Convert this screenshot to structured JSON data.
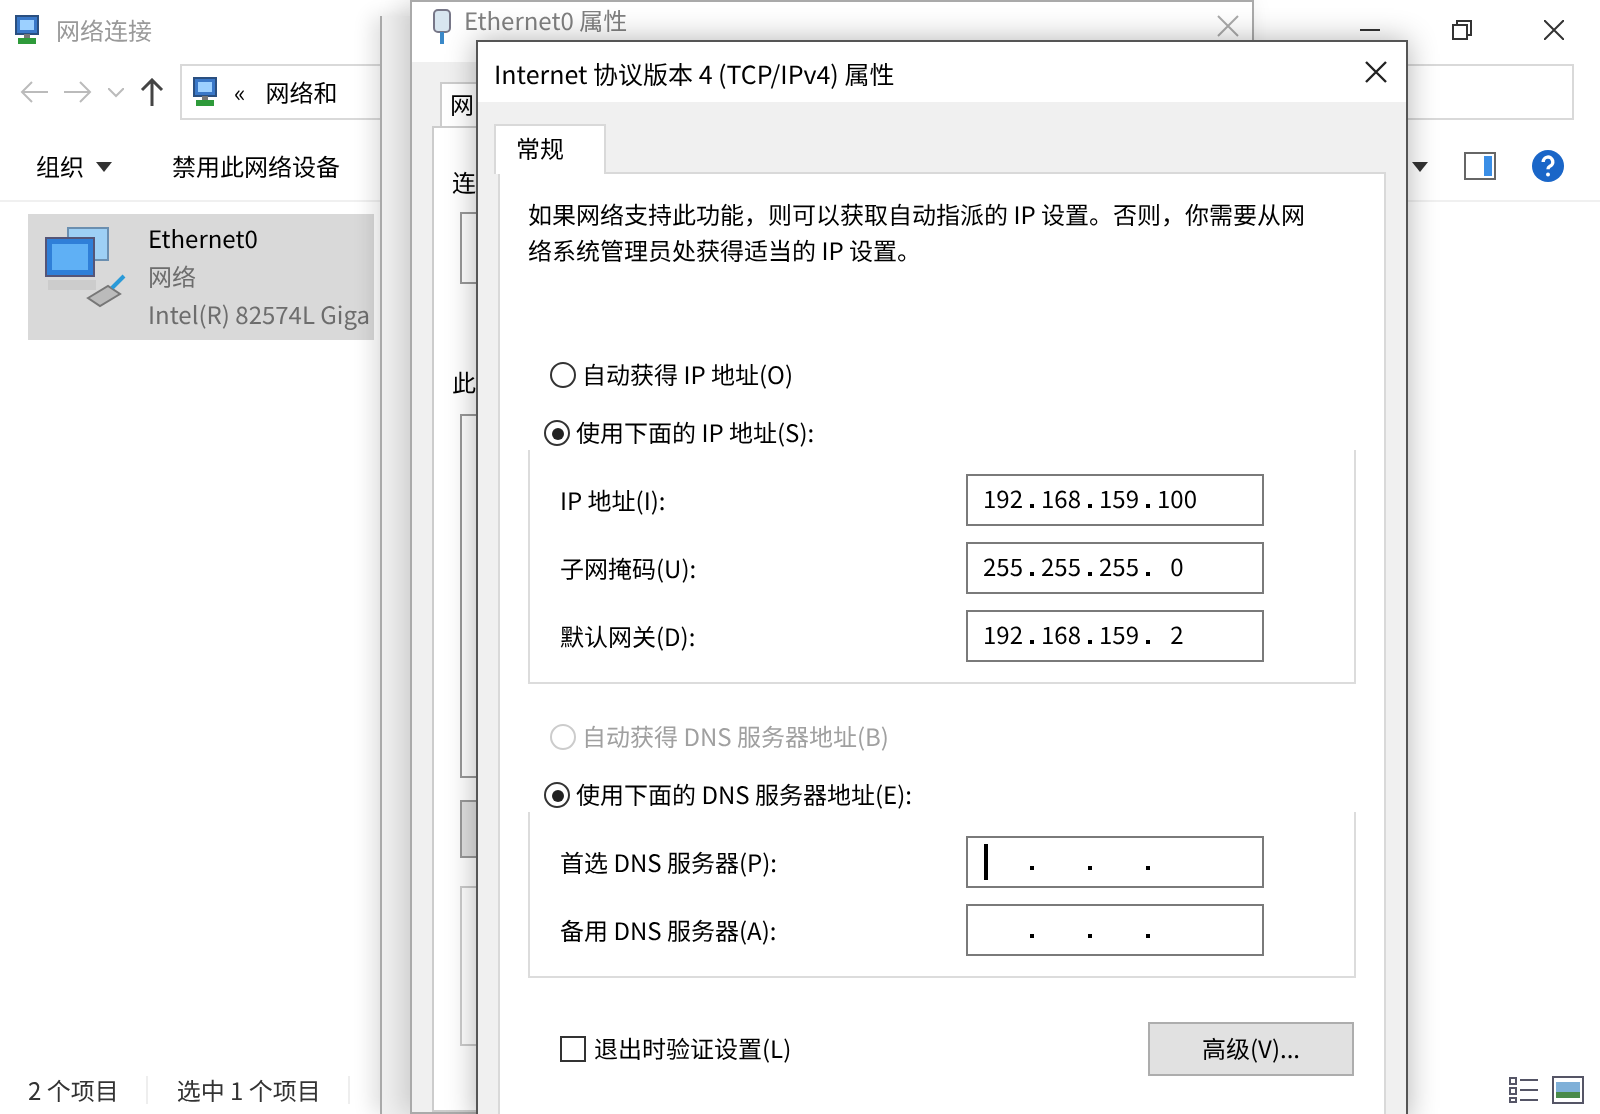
{
  "explorer": {
    "title": "网络连接",
    "address": {
      "separator": "«",
      "crumb": "网络和"
    },
    "toolbar": [
      "组织",
      "禁用此网络设备"
    ],
    "items": [
      {
        "name": "Ethernet0",
        "type": "网络",
        "device": "Intel(R) 82574L Giga",
        "selected": true
      }
    ],
    "status_bar": [
      "2 个项目",
      "选中 1 个项目"
    ]
  },
  "back_window": {
    "title": "Ethernet0 属性",
    "tab": "网",
    "labels": [
      "连",
      "此"
    ]
  },
  "dialog": {
    "title": "Internet 协议版本 4 (TCP/IPv4) 属性",
    "tabs": [
      {
        "label": "常规",
        "selected": true
      }
    ],
    "description": "如果网络支持此功能，则可以获取自动指派的 IP 设置。否则，你需要从网络系统管理员处获得适当的 IP 设置。",
    "ip_modes": [
      {
        "label": "自动获得 IP 地址(O)",
        "selected": false,
        "disabled": false
      },
      {
        "label": "使用下面的 IP 地址(S):",
        "selected": true,
        "disabled": false
      }
    ],
    "ip_fields": [
      {
        "label": "IP 地址(I):",
        "octets": [
          "192",
          "168",
          "159",
          "100"
        ],
        "focused": false
      },
      {
        "label": "子网掩码(U):",
        "octets": [
          "255",
          "255",
          "255",
          "0"
        ],
        "focused": false
      },
      {
        "label": "默认网关(D):",
        "octets": [
          "192",
          "168",
          "159",
          "2"
        ],
        "focused": false
      }
    ],
    "dns_modes": [
      {
        "label": "自动获得 DNS 服务器地址(B)",
        "selected": false,
        "disabled": true
      },
      {
        "label": "使用下面的 DNS 服务器地址(E):",
        "selected": true,
        "disabled": false
      }
    ],
    "dns_fields": [
      {
        "label": "首选 DNS 服务器(P):",
        "focused": true
      },
      {
        "label": "备用 DNS 服务器(A):",
        "focused": false
      }
    ],
    "validate": {
      "label": "退出时验证设置(L)",
      "checked": false
    },
    "advanced_button": "高级(V)..."
  }
}
